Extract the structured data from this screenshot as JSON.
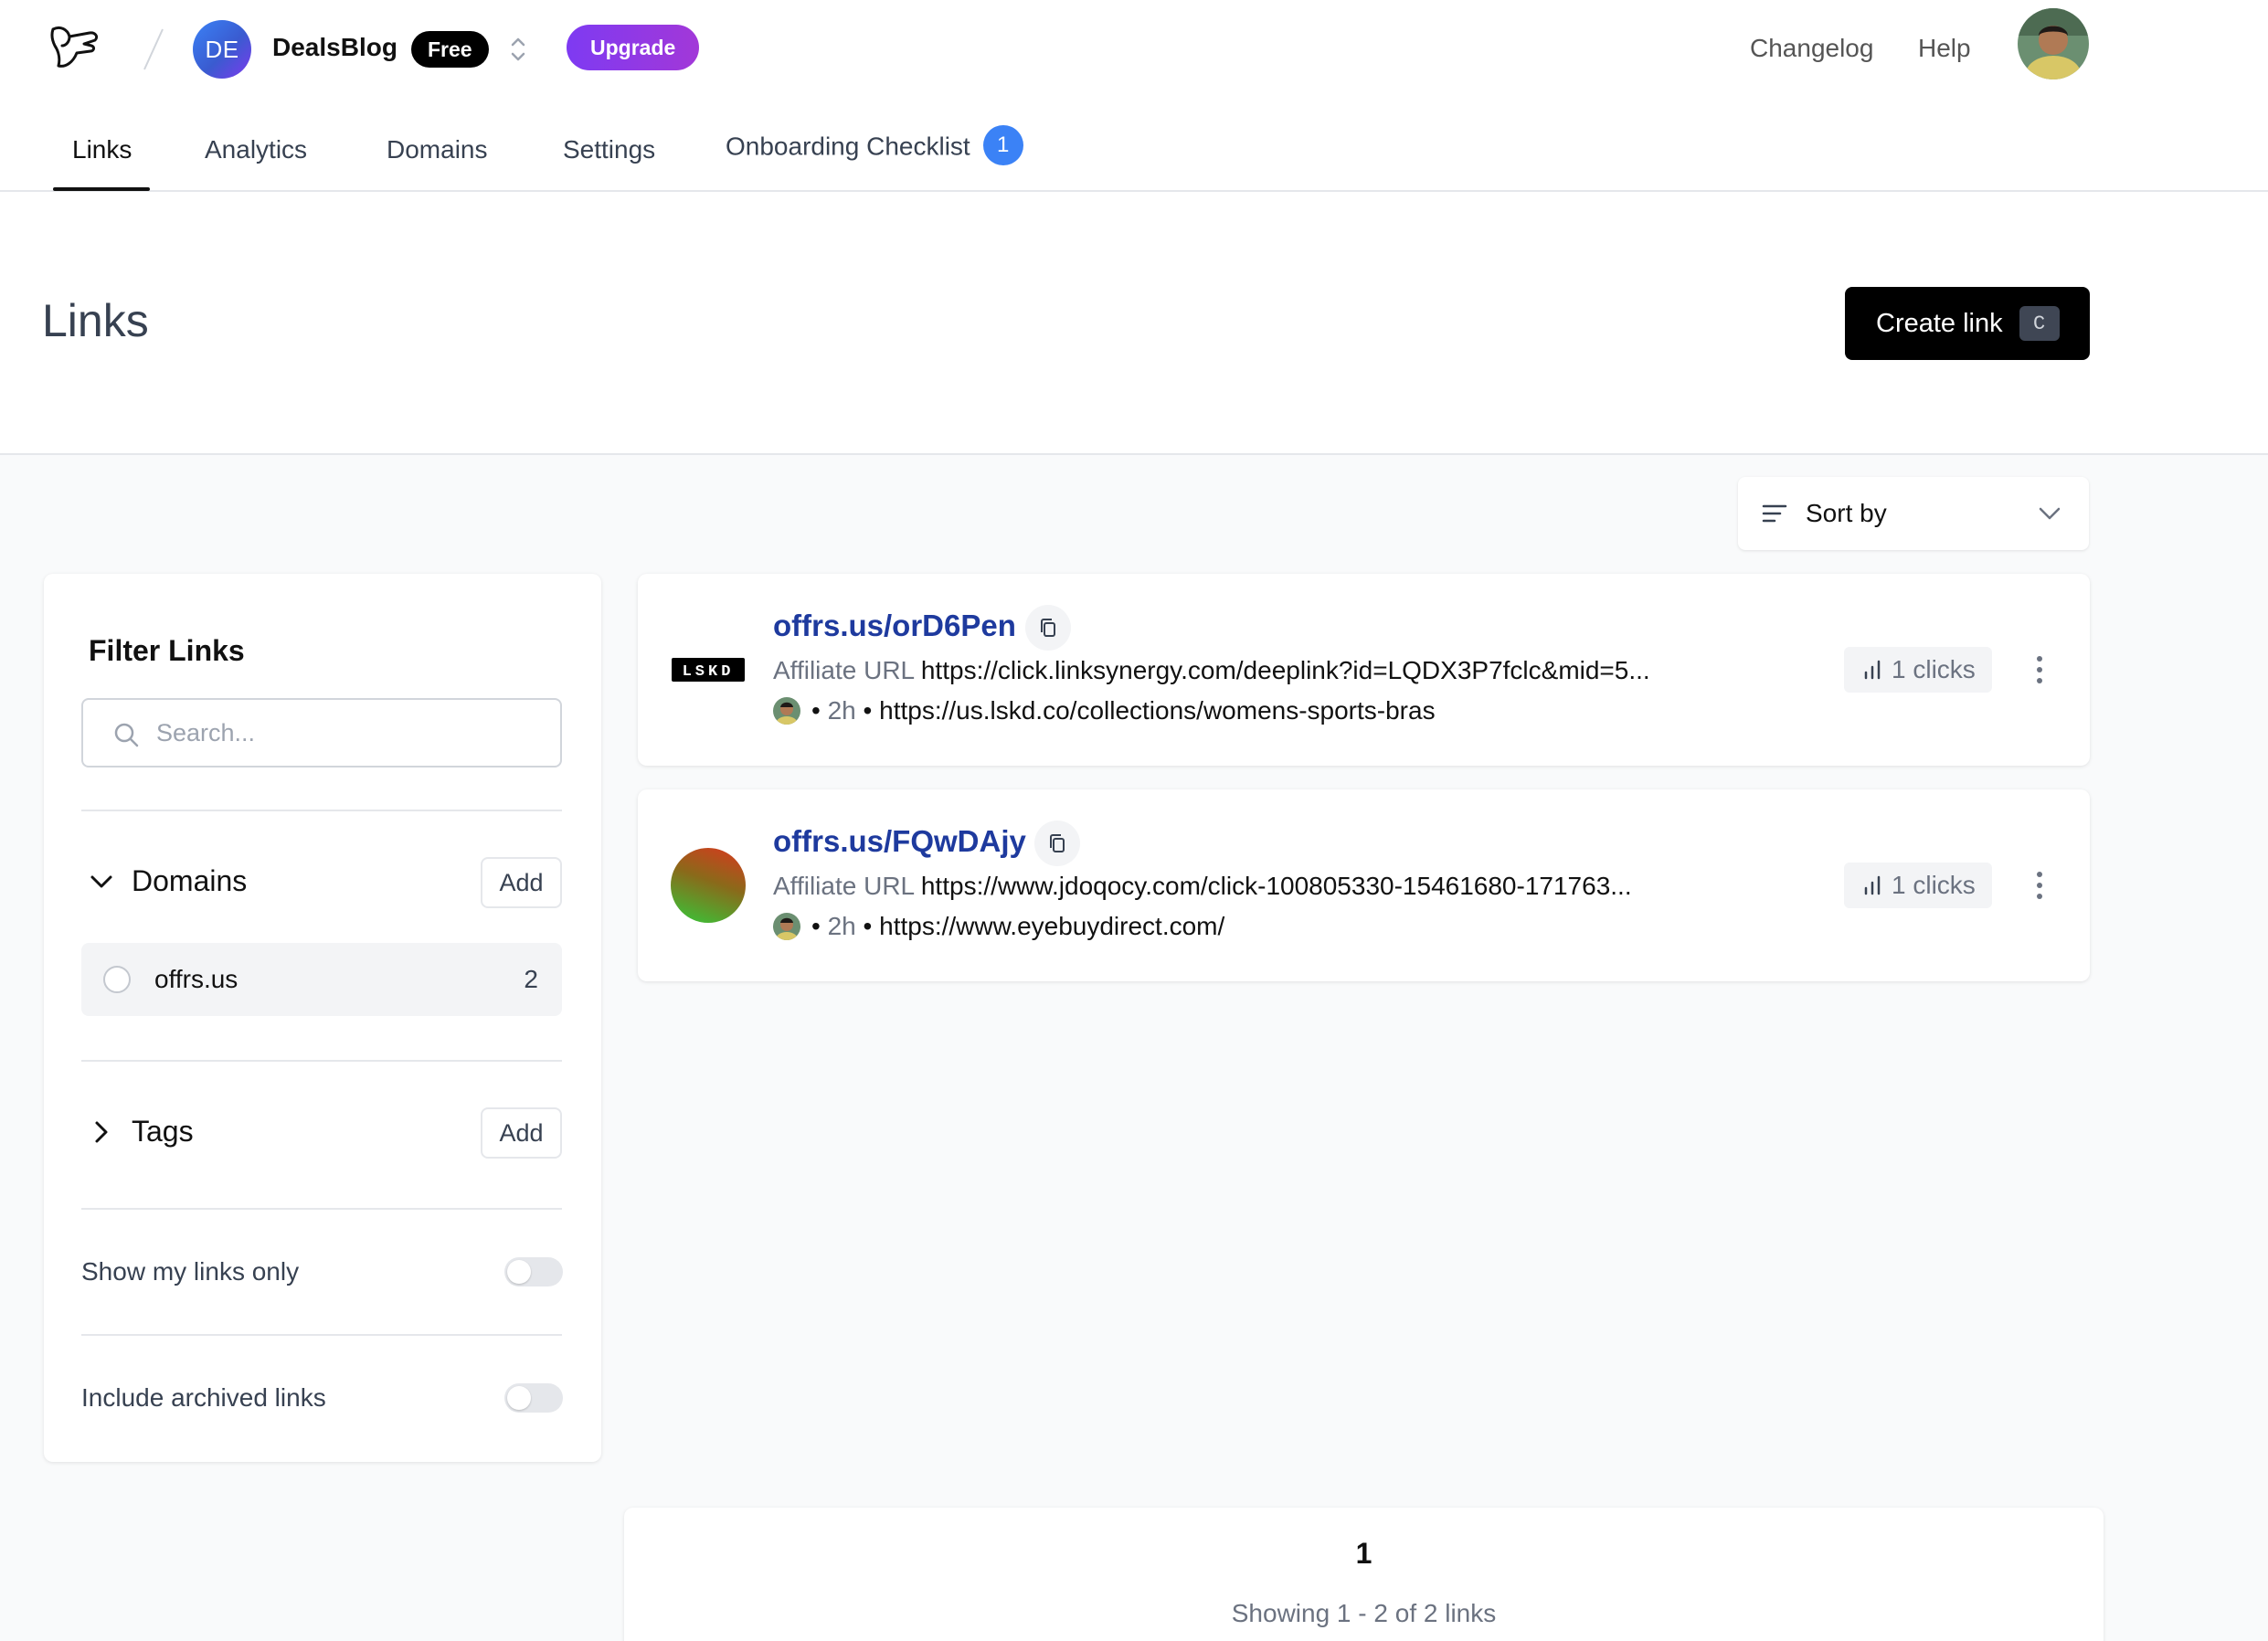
{
  "header": {
    "team_initials": "DE",
    "team_name": "DealsBlog",
    "plan_badge": "Free",
    "upgrade_label": "Upgrade",
    "changelog_label": "Changelog",
    "help_label": "Help"
  },
  "tabs": [
    {
      "label": "Links",
      "active": true
    },
    {
      "label": "Analytics",
      "active": false
    },
    {
      "label": "Domains",
      "active": false
    },
    {
      "label": "Settings",
      "active": false
    },
    {
      "label": "Onboarding Checklist",
      "active": false,
      "count": "1"
    }
  ],
  "page": {
    "title": "Links",
    "create_label": "Create link",
    "create_shortcut": "C"
  },
  "sort": {
    "label": "Sort by"
  },
  "filters": {
    "title": "Filter Links",
    "search_placeholder": "Search...",
    "domains": {
      "title": "Domains",
      "add_label": "Add",
      "expanded": true,
      "items": [
        {
          "name": "offrs.us",
          "count": "2"
        }
      ]
    },
    "tags": {
      "title": "Tags",
      "add_label": "Add",
      "expanded": false
    },
    "show_my_links": {
      "label": "Show my links only",
      "on": false
    },
    "include_archived": {
      "label": "Include archived links",
      "on": false
    }
  },
  "links": [
    {
      "short_url": "offrs.us/orD6Pen",
      "logo": "LSKD",
      "affiliate_label": "Affiliate URL",
      "affiliate_url": "https://click.linksynergy.com/deeplink?id=LQDX3P7fclc&mid=5...",
      "time": "2h",
      "destination": "https://us.lskd.co/collections/womens-sports-bras",
      "clicks": "1 clicks"
    },
    {
      "short_url": "offrs.us/FQwDAjy",
      "logo": "",
      "affiliate_label": "Affiliate URL",
      "affiliate_url": "https://www.jdoqocy.com/click-100805330-15461680-171763...",
      "time": "2h",
      "destination": "https://www.eyebuydirect.com/",
      "clicks": "1 clicks"
    }
  ],
  "pagination": {
    "current_page": "1",
    "showing": "Showing 1 - 2 of 2 links"
  },
  "colors": {
    "accent_blue": "#3b82f6",
    "link_blue": "#1e3a9e",
    "upgrade_purple": "#7e3af2"
  },
  "icons": [
    "app-logo-icon",
    "chevron-up-down-icon",
    "sort-icon",
    "chevron-down-icon",
    "search-icon",
    "chevron-right-icon",
    "copy-icon",
    "bar-chart-icon",
    "more-vertical-icon"
  ]
}
